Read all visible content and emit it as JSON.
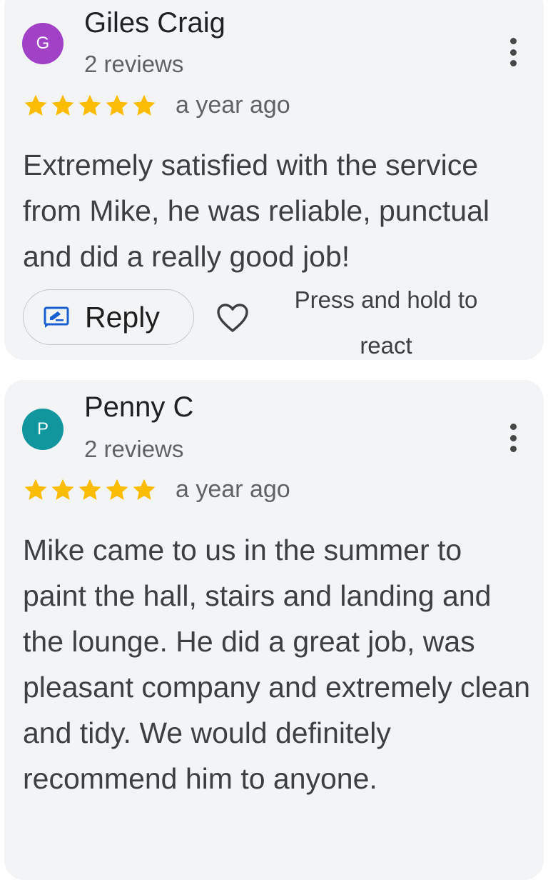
{
  "reviews": [
    {
      "avatar_letter": "G",
      "avatar_color": "#a142c6",
      "name": "Giles Craig",
      "review_count": "2 reviews",
      "rating": 5,
      "time": "a year ago",
      "text": "Extremely satisfied with the service from Mike, he was reliable, punctual and did a really good job!",
      "reply_label": "Reply",
      "react_hint": "Press and hold to react"
    },
    {
      "avatar_letter": "P",
      "avatar_color": "#12969e",
      "name": "Penny C",
      "review_count": "2 reviews",
      "rating": 5,
      "time": "a year ago",
      "text": "Mike came to us in the summer to paint the hall, stairs and landing and the lounge. He did a great job, was pleasant company and extremely clean and tidy. We would definitely recommend him to anyone."
    }
  ],
  "icons": {
    "star": "star-icon",
    "more": "more-vert-icon",
    "reply": "reply-icon",
    "heart": "heart-outline-icon"
  },
  "colors": {
    "star": "#fbbc04",
    "reply_icon": "#1a5fd0",
    "card_bg": "#f3f4f6"
  }
}
